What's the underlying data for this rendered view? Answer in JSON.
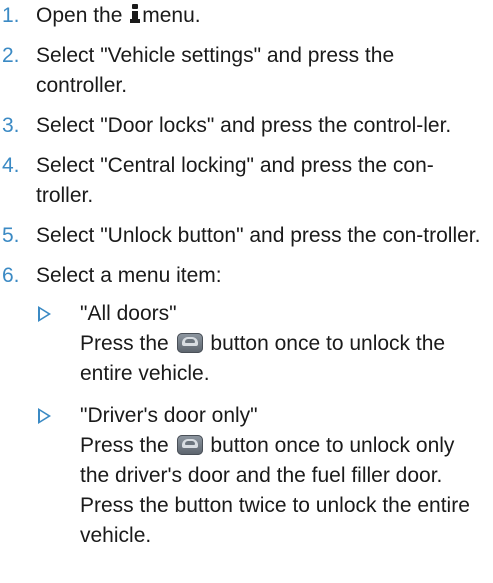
{
  "steps": [
    {
      "number": "1.",
      "before": "Open the",
      "icon": "info-icon",
      "after": "menu."
    },
    {
      "number": "2.",
      "text": "Select \"Vehicle settings\" and press the controller."
    },
    {
      "number": "3.",
      "text": "Select \"Door locks\" and press the control-ler."
    },
    {
      "number": "4.",
      "text": "Select \"Central locking\" and press the con-troller."
    },
    {
      "number": "5.",
      "text": "Select \"Unlock button\" and press the con-troller."
    },
    {
      "number": "6.",
      "text": "Select a menu item:"
    }
  ],
  "sub_items": [
    {
      "title": "\"All doors\"",
      "press_before": "Press the",
      "icon": "unlock-button-icon",
      "press_after": "button once to unlock the entire vehicle."
    },
    {
      "title": "\"Driver's door only\"",
      "press_before": "Press the",
      "icon": "unlock-button-icon",
      "press_after": "button once to unlock only the driver's door and the fuel filler door.",
      "extra": "Press the button twice to unlock the entire vehicle."
    }
  ],
  "colors": {
    "accent": "#3b8ac4",
    "text": "#1a1a1a"
  }
}
